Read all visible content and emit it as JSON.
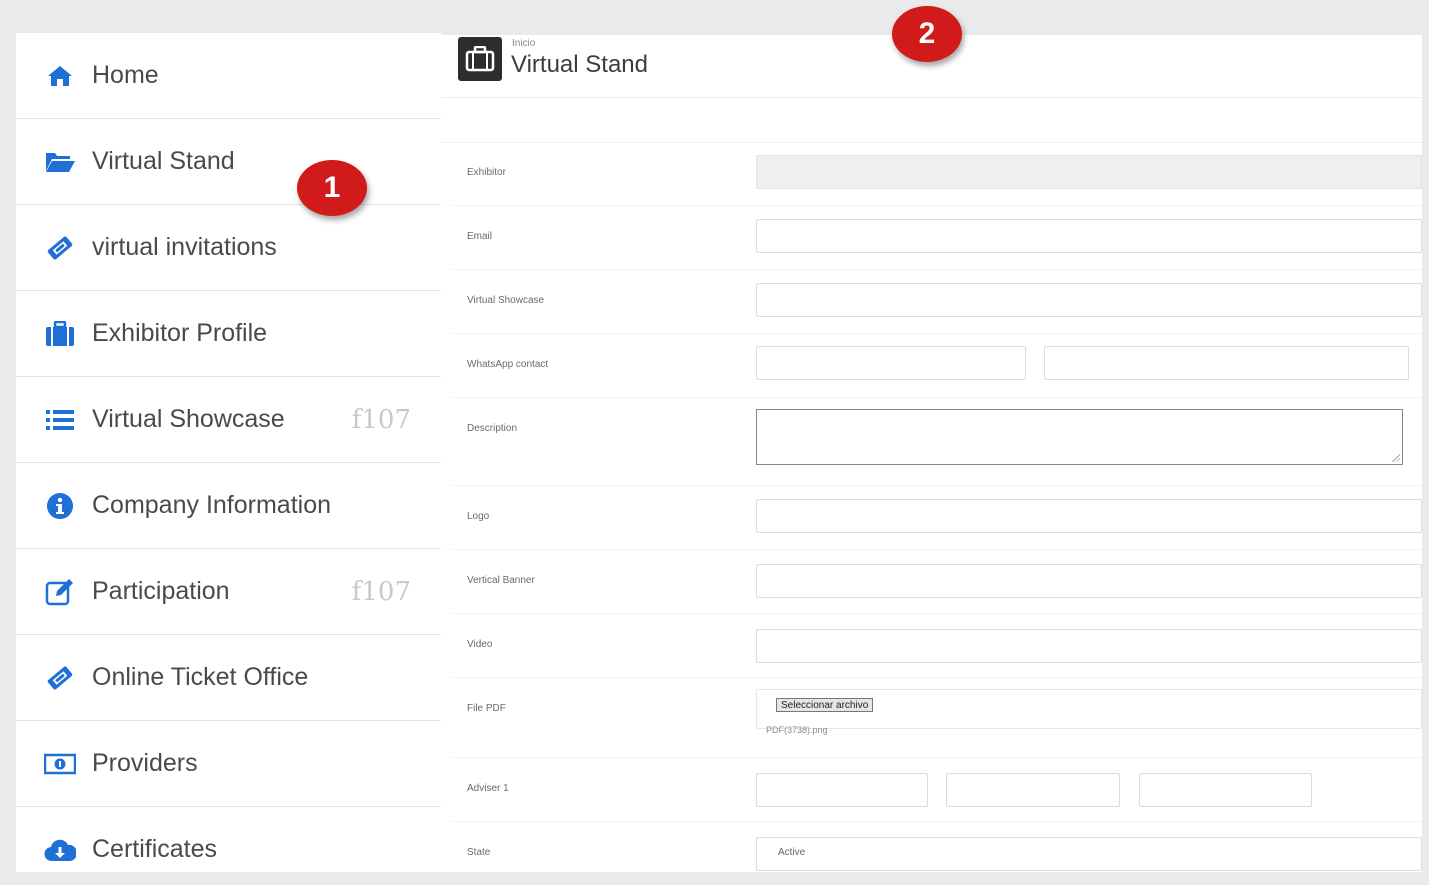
{
  "colors": {
    "accent": "#1e6fd6",
    "badge": "#d11a1a"
  },
  "sidebar": {
    "items": [
      {
        "label": "Home",
        "icon": "home-icon",
        "note": ""
      },
      {
        "label": "Virtual Stand",
        "icon": "folder-open-icon",
        "note": ""
      },
      {
        "label": "virtual invitations",
        "icon": "ticket-icon",
        "note": ""
      },
      {
        "label": "Exhibitor Profile",
        "icon": "briefcase-icon",
        "note": ""
      },
      {
        "label": "Virtual Showcase",
        "icon": "list-icon",
        "note": "f107"
      },
      {
        "label": "Company Information",
        "icon": "info-circle-icon",
        "note": ""
      },
      {
        "label": "Participation",
        "icon": "edit-icon",
        "note": "f107"
      },
      {
        "label": "Online Ticket Office",
        "icon": "ticket-icon",
        "note": ""
      },
      {
        "label": "Providers",
        "icon": "money-icon",
        "note": ""
      },
      {
        "label": "Certificates",
        "icon": "cloud-download-icon",
        "note": ""
      }
    ]
  },
  "header": {
    "breadcrumb": "Inicio",
    "title": "Virtual Stand"
  },
  "form": {
    "exhibitor_label": "Exhibitor",
    "email_label": "Email",
    "showcase_label": "Virtual Showcase",
    "whatsapp_label": "WhatsApp contact",
    "description_label": "Description",
    "logo_label": "Logo",
    "banner_label": "Vertical Banner",
    "video_label": "Video",
    "pdf_label": "File PDF",
    "pdf_button": "Seleccionar archivo",
    "pdf_caption": "PDF(3738).png",
    "adviser_label": "Adviser 1",
    "state_label": "State",
    "state_value": "Active"
  },
  "badges": {
    "one": "1",
    "two": "2"
  }
}
